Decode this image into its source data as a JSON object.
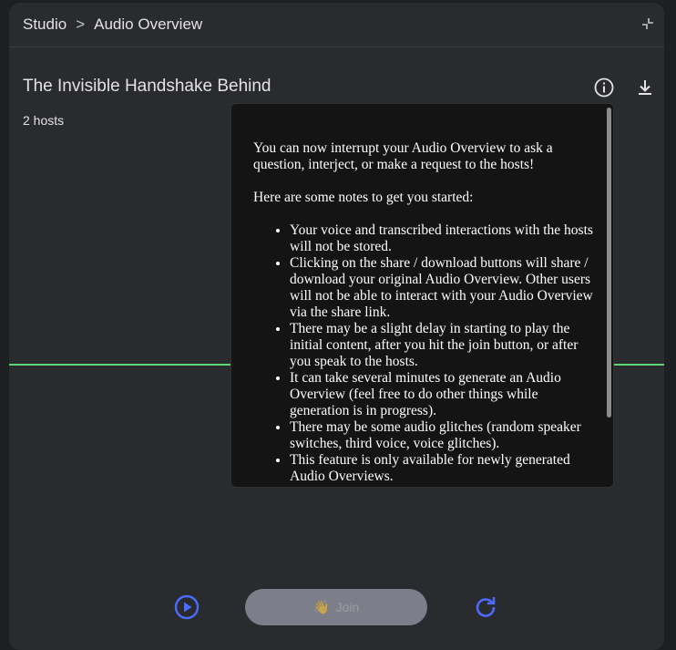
{
  "header": {
    "breadcrumb_root": "Studio",
    "breadcrumb_separator": ">",
    "breadcrumb_current": "Audio Overview",
    "collapse_icon": "collapse-icon"
  },
  "overview": {
    "title": "The Invisible Handshake Behind",
    "hosts": "2 hosts",
    "info_icon": "info-icon",
    "download_icon": "download-icon"
  },
  "tooltip": {
    "intro": "You can now interrupt your Audio Overview to ask a question, interject, or make a request to the hosts!",
    "notes_heading": "Here are some notes to get you started:",
    "notes": [
      "Your voice and transcribed interactions with the hosts will not be stored.",
      "Clicking on the share / download buttons will share / download your original Audio Overview. Other users will not be able to interact with your Audio Overview via the share link.",
      "There may be a slight delay in starting to play the initial content, after you hit the join button, or after you speak to the hosts.",
      "It can take several minutes to generate an Audio Overview (feel free to do other things while generation is in progress).",
      "There may be some audio glitches (random speaker switches, third voice, voice glitches).",
      "This feature is only available for newly generated Audio Overviews."
    ]
  },
  "controls": {
    "play_icon": "play-icon",
    "join_emoji": "👋",
    "join_label": "Join",
    "refresh_icon": "refresh-icon"
  },
  "colors": {
    "panel": "#2a2b2e",
    "accent": "#4b6bff",
    "waveform": "#5fd67a",
    "tooltip_bg": "#141414"
  }
}
